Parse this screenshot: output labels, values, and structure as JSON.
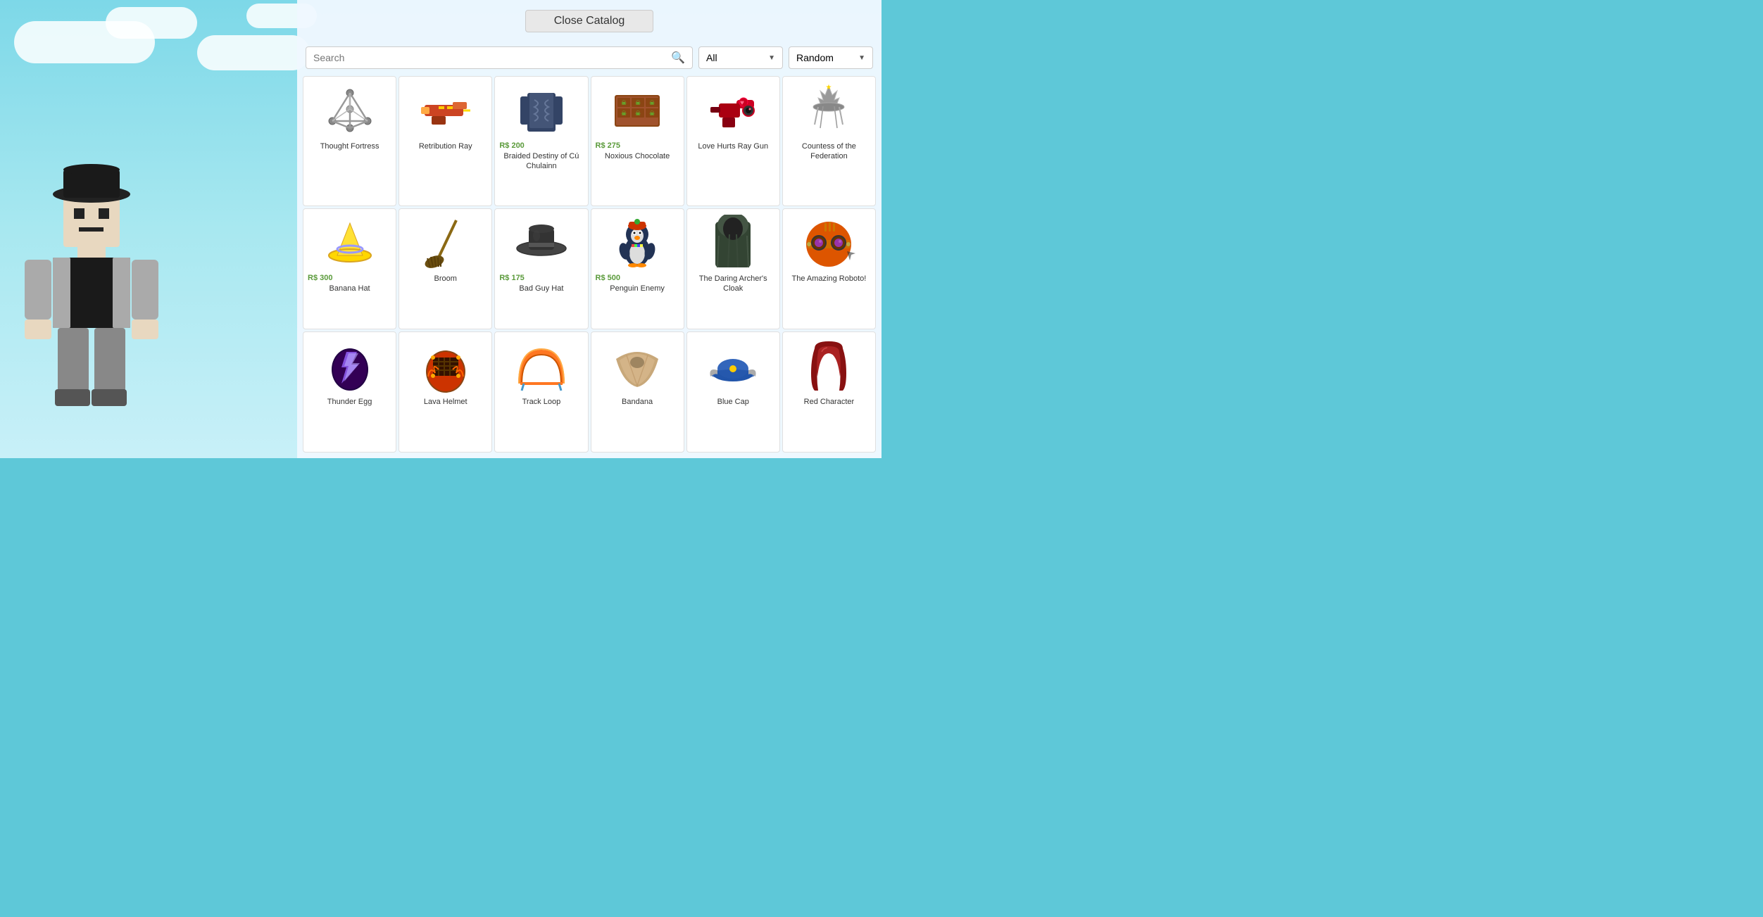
{
  "header": {
    "close_label": "Close Catalog"
  },
  "search": {
    "placeholder": "Search",
    "filter_label": "All",
    "sort_label": "Random"
  },
  "items": [
    {
      "id": 1,
      "name": "Thought Fortress",
      "price": null,
      "color": "#aaa"
    },
    {
      "id": 2,
      "name": "Retribution Ray",
      "price": null,
      "color": "#cc4422"
    },
    {
      "id": 3,
      "name": "Braided Destiny of Cú Chulainn",
      "price": "R$ 200",
      "color": "#334466"
    },
    {
      "id": 4,
      "name": "Noxious Chocolate",
      "price": "R$ 275",
      "color": "#8B4513"
    },
    {
      "id": 5,
      "name": "Love Hurts Ray Gun",
      "price": null,
      "color": "#cc0022"
    },
    {
      "id": 6,
      "name": "Countess of the Federation",
      "price": null,
      "color": "#884488"
    },
    {
      "id": 7,
      "name": "Banana Hat",
      "price": "R$ 300",
      "color": "#FFD700"
    },
    {
      "id": 8,
      "name": "Broom",
      "price": null,
      "color": "#8B6914"
    },
    {
      "id": 9,
      "name": "Bad Guy Hat",
      "price": "R$ 175",
      "color": "#444"
    },
    {
      "id": 10,
      "name": "Penguin Enemy",
      "price": "R$ 500",
      "color": "#223355"
    },
    {
      "id": 11,
      "name": "The Daring Archer's Cloak",
      "price": null,
      "color": "#334433"
    },
    {
      "id": 12,
      "name": "The Amazing Roboto!",
      "price": null,
      "color": "#cc5522"
    },
    {
      "id": 13,
      "name": "Thunder Egg",
      "price": null,
      "color": "#220044"
    },
    {
      "id": 14,
      "name": "Lava Helmet",
      "price": null,
      "color": "#cc3300"
    },
    {
      "id": 15,
      "name": "Track Loop",
      "price": null,
      "color": "#ff7722"
    },
    {
      "id": 16,
      "name": "Bandana",
      "price": null,
      "color": "#c8a87a"
    },
    {
      "id": 17,
      "name": "Blue Cap",
      "price": null,
      "color": "#2255aa"
    },
    {
      "id": 18,
      "name": "Red Character",
      "price": null,
      "color": "#881111"
    }
  ]
}
